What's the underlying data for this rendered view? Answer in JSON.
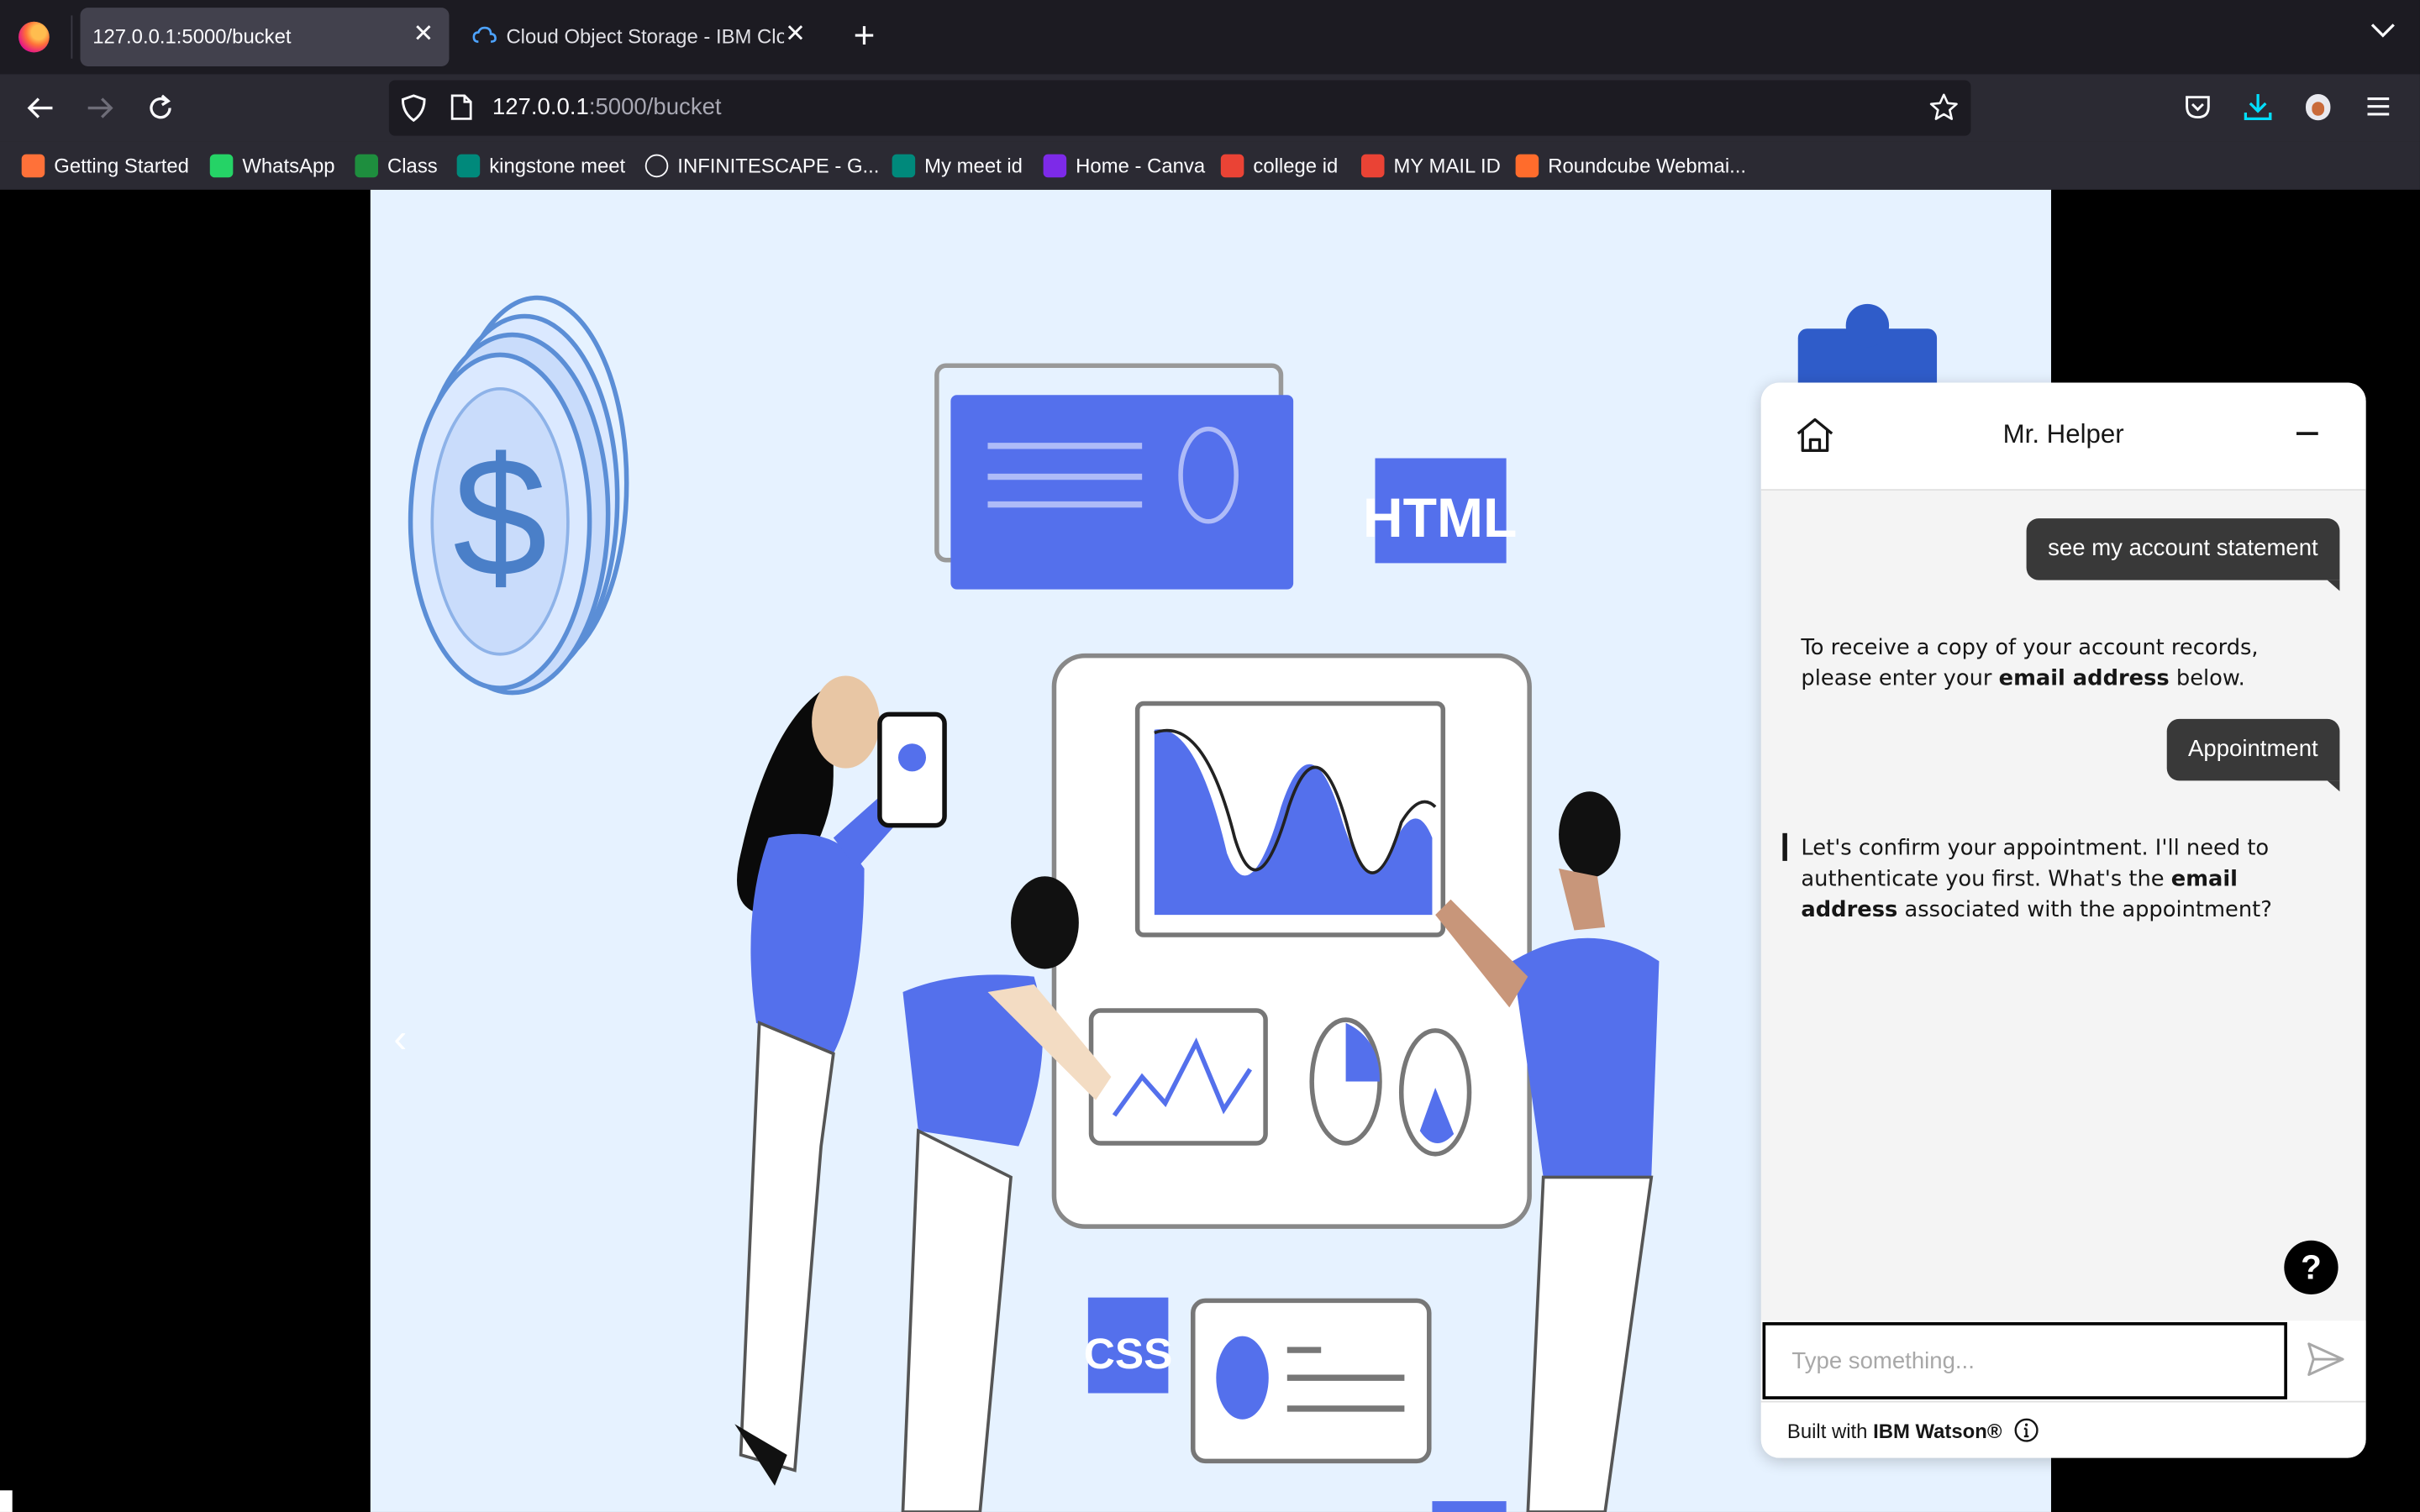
{
  "browser": {
    "tabs": [
      {
        "label": "127.0.0.1:5000/bucket",
        "active": true
      },
      {
        "label": "Cloud Object Storage - IBM Cloud",
        "active": false
      }
    ],
    "url": {
      "host": "127.0.0.1",
      "rest": ":5000/bucket"
    },
    "bookmarks": [
      {
        "label": "Getting Started",
        "icon": "firefox-icon",
        "color": "#ff7139"
      },
      {
        "label": "WhatsApp",
        "icon": "whatsapp-icon",
        "color": "#25d366"
      },
      {
        "label": "Class",
        "icon": "classroom-icon",
        "color": "#1e8e3e"
      },
      {
        "label": "kingstone meet",
        "icon": "meet-icon",
        "color": "#00897b"
      },
      {
        "label": "INFINITESCAPE - G...",
        "icon": "globe-icon",
        "color": "#2b2a33"
      },
      {
        "label": "My meet id",
        "icon": "meet-icon",
        "color": "#00897b"
      },
      {
        "label": "Home - Canva",
        "icon": "canva-icon",
        "color": "#7d2ae8"
      },
      {
        "label": "college id",
        "icon": "gmail-icon",
        "color": "#ea4335"
      },
      {
        "label": "MY MAIL ID",
        "icon": "gmail-icon",
        "color": "#ea4335"
      },
      {
        "label": "Roundcube Webmai...",
        "icon": "cpanel-icon",
        "color": "#ff6c2c"
      }
    ]
  },
  "hero": {
    "labels": {
      "html": "HTML",
      "css": "CSS",
      "dollar": "$"
    },
    "prev_arrow": "‹"
  },
  "chat": {
    "title": "Mr. Helper",
    "messages": [
      {
        "from": "user",
        "text": "see my account statement"
      },
      {
        "from": "bot",
        "parts": [
          "To receive a copy of your account records, please enter your ",
          "email address",
          " below."
        ]
      },
      {
        "from": "user",
        "text": "Appointment"
      },
      {
        "from": "bot",
        "parts": [
          "Let's confirm your appointment. I'll need to authenticate you first. What's the ",
          "email address",
          " associated with the appointment?"
        ]
      }
    ],
    "help_label": "?",
    "input_placeholder": "Type something...",
    "footer": {
      "prefix": "Built with ",
      "brand": "IBM Watson®"
    }
  }
}
